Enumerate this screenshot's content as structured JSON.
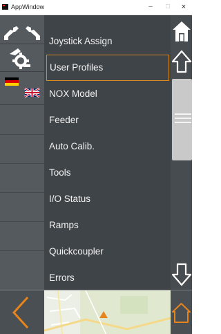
{
  "window": {
    "title": "AppWindow",
    "minimize_glyph": "–",
    "maximize_glyph": "□",
    "close_glyph": "×"
  },
  "left_bar": {
    "items": [
      {
        "icon": "robot-arms-icon"
      },
      {
        "icon": "settings-machine-icon"
      },
      {
        "icon": "language-flags-icon"
      }
    ]
  },
  "menu": {
    "items": [
      {
        "label": "Joystick Assign"
      },
      {
        "label": "User Profiles",
        "selected": true
      },
      {
        "label": "NOX Model"
      },
      {
        "label": "Feeder"
      },
      {
        "label": "Auto Calib."
      },
      {
        "label": "Tools"
      },
      {
        "label": "I/O Status"
      },
      {
        "label": "Ramps"
      },
      {
        "label": "Quickcoupler"
      },
      {
        "label": "Errors"
      }
    ]
  },
  "colors": {
    "accent": "#e8841c",
    "panel": "#3f4448",
    "sidebar": "#555a5e",
    "selection_border": "#d98a1f"
  },
  "bottom_bar": {
    "back_icon": "chevron-left-icon",
    "home_icon": "home-outline-icon",
    "map": "minimap"
  }
}
